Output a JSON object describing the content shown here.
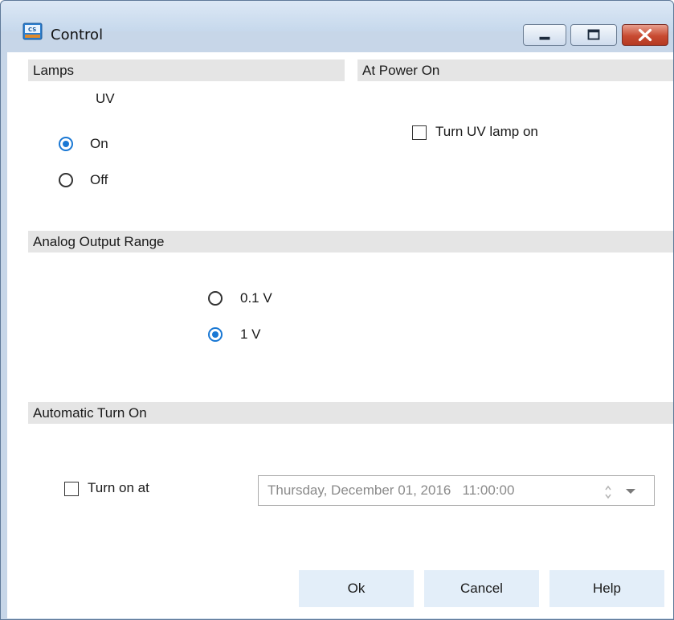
{
  "window": {
    "title": "Control",
    "icon": "cs-app-icon",
    "controls": [
      "minimize-icon",
      "maximize-icon",
      "close-icon"
    ]
  },
  "lamps": {
    "header": "Lamps",
    "uv_label": "UV",
    "options": [
      {
        "label": "On",
        "selected": true
      },
      {
        "label": "Off",
        "selected": false
      }
    ]
  },
  "power_on": {
    "header": "At Power On",
    "checkbox_label": "Turn UV lamp on",
    "checked": false
  },
  "analog": {
    "header": "Analog Output Range",
    "options": [
      {
        "label": "0.1 V",
        "selected": false
      },
      {
        "label": "1 V",
        "selected": true
      }
    ]
  },
  "auto_turn_on": {
    "header": "Automatic Turn On",
    "checkbox_label": "Turn on at",
    "checked": false,
    "datetime_value": "Thursday, December 01, 2016   11:00:00"
  },
  "buttons": {
    "ok": "Ok",
    "cancel": "Cancel",
    "help": "Help"
  },
  "colors": {
    "accent": "#1a78d4",
    "section_bar": "#e5e5e5",
    "button_bg": "#e3eef9",
    "close_button": "#c84b32"
  }
}
